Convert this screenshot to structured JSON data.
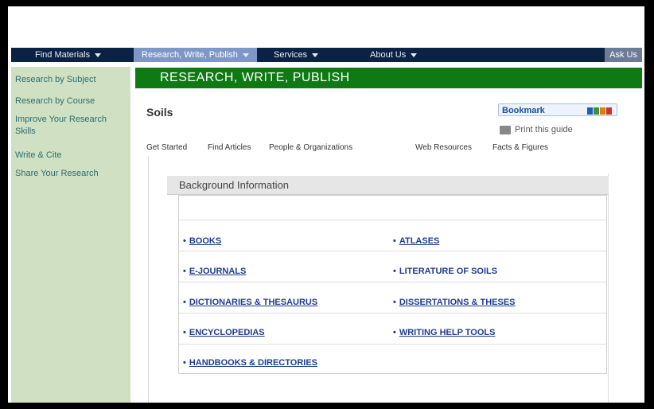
{
  "nav": {
    "items": [
      {
        "label": "Find Materials"
      },
      {
        "label": "Research, Write, Publish"
      },
      {
        "label": "Services"
      },
      {
        "label": "About Us"
      }
    ],
    "ask_label": "Ask Us"
  },
  "sidebar": {
    "items": [
      {
        "label": "Research by Subject"
      },
      {
        "label": "Research by Course"
      },
      {
        "label": "Improve Your Research Skills"
      },
      {
        "label": "Write & Cite"
      },
      {
        "label": "Share Your Research"
      }
    ]
  },
  "section_title": "RESEARCH, WRITE, PUBLISH",
  "guide": {
    "title": "Soils",
    "bookmark_label": "Bookmark",
    "print_label": "Print this guide"
  },
  "tabs": [
    {
      "label": "Get Started"
    },
    {
      "label": "Find Articles"
    },
    {
      "label": "People & Organizations"
    },
    {
      "label": "Web Resources"
    },
    {
      "label": "Facts & Figures"
    }
  ],
  "box": {
    "header": "Background Information",
    "links": [
      {
        "label": "BOOKS"
      },
      {
        "label": "ATLASES"
      },
      {
        "label": "E-JOURNALS"
      },
      {
        "label": "LITERATURE OF SOILS"
      },
      {
        "label": "DICTIONARIES & THESAURUS"
      },
      {
        "label": "DISSERTATIONS & THESES"
      },
      {
        "label": "ENCYCLOPEDIAS"
      },
      {
        "label": "WRITING HELP TOOLS"
      },
      {
        "label": "HANDBOOKS & DIRECTORIES"
      }
    ],
    "bullet": "•"
  },
  "colors": {
    "nav_bg": "#0c2244",
    "nav_active": "#7f97c6",
    "sidebar_bg": "#cfe1c2",
    "title_bar": "#0f7a14",
    "link": "#1f3c8f"
  }
}
